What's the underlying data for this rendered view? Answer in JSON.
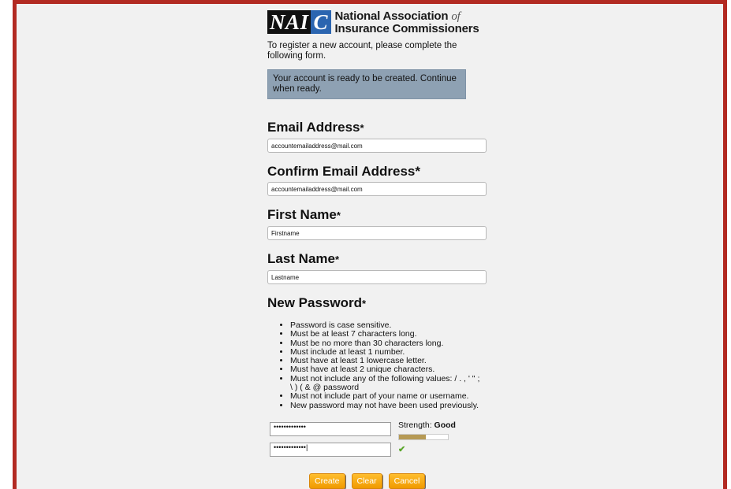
{
  "logo": {
    "mark": "NAI",
    "mark_c": "C",
    "line1": "National Association",
    "line1_of": "of",
    "line2": "Insurance Commissioners"
  },
  "intro": "To register a new account, please complete the following form.",
  "alert": "Your account is ready to be created. Continue when ready.",
  "fields": {
    "email": {
      "label": "Email Address",
      "req": "*",
      "value": "accountemailaddress@mail.com"
    },
    "confirm_email": {
      "label": "Confirm Email Address*",
      "value": "accountemailaddress@mail.com"
    },
    "first_name": {
      "label": "First Name",
      "req": "*",
      "value": "Firstname"
    },
    "last_name": {
      "label": "Last Name",
      "req": "*",
      "value": "Lastname"
    },
    "new_password": {
      "label": "New Password",
      "req": "*"
    }
  },
  "password_rules": [
    "Password is case sensitive.",
    "Must be at least 7 characters long.",
    "Must be no more than 30 characters long.",
    "Must include at least 1 number.",
    "Must have at least 1 lowercase letter.",
    "Must have at least 2 unique characters.",
    "Must not include any of the following values: / . , ' \" ; \\ ) ( & @ password",
    "Must not include part of your name or username.",
    "New password may not have been used previously."
  ],
  "password": {
    "masked": "•••••••••••••",
    "confirm_masked": "•••••••••••••|",
    "strength_prefix": "Strength: ",
    "strength_value": "Good",
    "strength_level": 0.55,
    "match_icon": "check-icon",
    "match_glyph": "✔"
  },
  "buttons": {
    "create": "Create",
    "clear": "Clear",
    "cancel": "Cancel"
  },
  "colors": {
    "frame": "#b22a22",
    "alert_bg": "#8ea1b3",
    "button": "#f5a300",
    "strength": "#b69a55",
    "logo_c": "#2b65b0"
  }
}
